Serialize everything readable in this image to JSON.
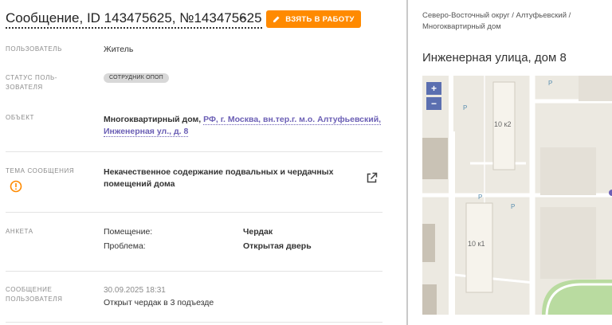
{
  "header": {
    "title": "Сообщение, ID 143475625, №143475625",
    "take_button": "ВЗЯТЬ В РАБОТУ"
  },
  "fields": {
    "user_label": "ПОЛЬЗОВАТЕЛЬ",
    "user_value": "Житель",
    "status_label_1": "СТАТУС ПОЛЬ-",
    "status_label_2": "ЗОВАТЕЛЯ",
    "status_badge": "СОТРУДНИК ОПОП",
    "object_label": "ОБЪЕКТ",
    "object_type": "Многоквартирный дом,",
    "object_address_1": "РФ, г. Москва, вн.тер.г. м.о. Алтуфьевский,",
    "object_address_2": "Инженерная ул., д. 8",
    "topic_label": "ТЕМА СООБЩЕНИЯ",
    "topic_line_1": "Некачественное содержание подвальных и чердачных",
    "topic_line_2": "помещений дома",
    "form_label": "АНКЕТА",
    "form_key_1": "Помещение:",
    "form_val_1": "Чердак",
    "form_key_2": "Проблема:",
    "form_val_2": "Открытая дверь",
    "message_label_1": "СООБЩЕНИЕ",
    "message_label_2": "ПОЛЬЗОВАТЕЛЯ",
    "message_date": "30.09.2025 18:31",
    "message_text": "Открыт чердак в 3 подъезде"
  },
  "side": {
    "breadcrumb_1": "Северо-Восточный округ / Алтуфьевский /",
    "breadcrumb_2": "Многоквартирный дом",
    "place_title": "Инженерная улица, дом 8",
    "map": {
      "zoom_in": "+",
      "zoom_out": "−",
      "building_1": "10 к2",
      "building_2": "10 к1",
      "parking_mark": "P"
    }
  },
  "colors": {
    "accent": "#ff8a00",
    "link": "#6b5fb5",
    "warning": "#ff8a00",
    "map_bg": "#ece9e1",
    "zoom": "#5b6fb0"
  }
}
